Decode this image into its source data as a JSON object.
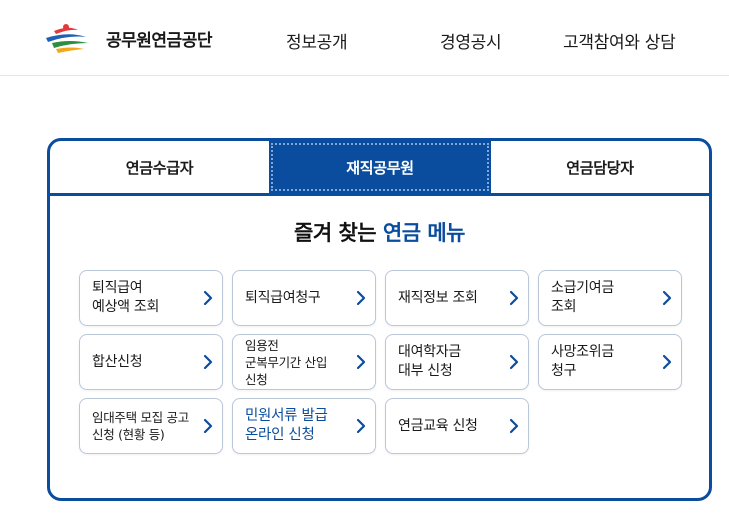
{
  "header": {
    "logo_text": "공무원연금공단",
    "nav": [
      "정보공개",
      "경영공시",
      "고객참여와 상담"
    ]
  },
  "tabs": [
    "연금수급자",
    "재직공무원",
    "연금담당자"
  ],
  "active_tab": "재직공무원",
  "title": {
    "prefix": "즐겨 찾는 ",
    "accent": "연금 메뉴"
  },
  "menu": [
    "퇴직급여\n예상액 조회",
    "퇴직급여청구",
    "재직정보 조회",
    "소급기여금\n조회",
    "합산신청",
    "임용전\n군복무기간 산입\n신청",
    "대여학자금\n대부 신청",
    "사망조위금\n청구",
    "임대주택 모집 공고\n신청 (현황 등)",
    "민원서류 발급\n온라인 신청",
    "연금교육 신청"
  ],
  "colors": {
    "brand": "#0a4d9e",
    "border": "#b9c7d8"
  }
}
